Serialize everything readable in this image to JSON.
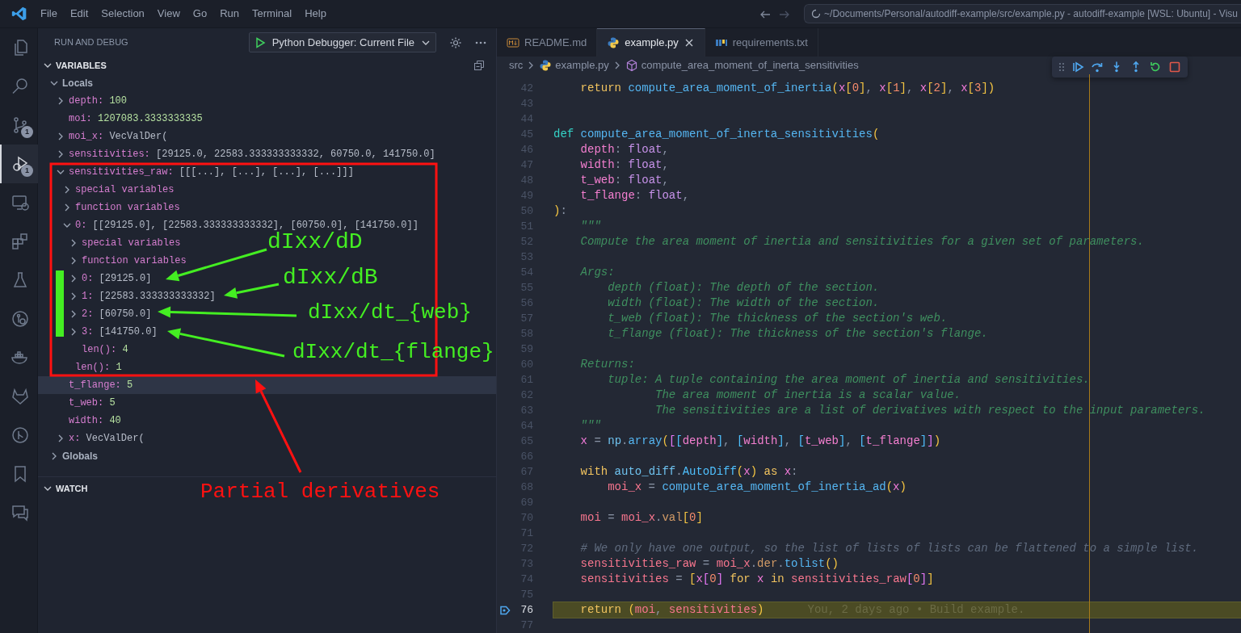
{
  "title_bar": {
    "menu": [
      "File",
      "Edit",
      "Selection",
      "View",
      "Go",
      "Run",
      "Terminal",
      "Help"
    ],
    "command_center": "~/Documents/Personal/autodiff-example/src/example.py - autodiff-example [WSL: Ubuntu] - Visu"
  },
  "activity_bar": [
    {
      "kind": "files",
      "selected": false
    },
    {
      "kind": "search",
      "selected": false
    },
    {
      "kind": "source-control",
      "selected": false,
      "badge": "1"
    },
    {
      "kind": "run-debug",
      "selected": true,
      "badge": "1"
    },
    {
      "kind": "remote",
      "selected": false
    },
    {
      "kind": "extensions",
      "selected": false
    },
    {
      "kind": "testing",
      "selected": false
    },
    {
      "kind": "git-graph",
      "selected": false
    },
    {
      "kind": "docker",
      "selected": false
    },
    {
      "kind": "gitlab",
      "selected": false
    },
    {
      "kind": "git-circle",
      "selected": false
    },
    {
      "kind": "bookmark",
      "selected": false
    },
    {
      "kind": "comments",
      "selected": false
    }
  ],
  "sidebar": {
    "title": "RUN AND DEBUG",
    "launch_config": "Python Debugger: Current File",
    "variables": {
      "title": "VARIABLES",
      "expanded": true,
      "scopes": [
        {
          "label": "Locals",
          "expanded": true,
          "children": [
            {
              "name": "depth:",
              "value": {
                "text": "100",
                "kind": "number"
              },
              "kind": "expandable",
              "expanded": false,
              "selected": false
            },
            {
              "name": "moi:",
              "value": {
                "text": "1207083.3333333335",
                "kind": "number"
              },
              "kind": "leaf",
              "selected": false
            },
            {
              "name": "moi_x:",
              "value": {
                "text": "VecValDer(",
                "kind": "object"
              },
              "kind": "expandable",
              "expanded": false,
              "selected": false
            },
            {
              "name": "sensitivities:",
              "value": {
                "text": "[29125.0, 22583.333333333332, 60750.0, 141750.0]",
                "kind": "object"
              },
              "kind": "expandable",
              "expanded": false,
              "selected": false
            },
            {
              "name": "sensitivities_raw:",
              "value": {
                "text": "[[[...], [...], [...], [...]]]",
                "kind": "object"
              },
              "kind": "expandable",
              "expanded": true,
              "selected": false,
              "children": [
                {
                  "name": "special variables",
                  "kind": "expandable",
                  "expanded": false,
                  "selected": false
                },
                {
                  "name": "function variables",
                  "kind": "expandable",
                  "expanded": false,
                  "selected": false
                },
                {
                  "name": "0:",
                  "value": {
                    "text": "[[29125.0], [22583.333333333332], [60750.0], [141750.0]]",
                    "kind": "object"
                  },
                  "kind": "expandable",
                  "expanded": true,
                  "selected": false,
                  "children": [
                    {
                      "name": "special variables",
                      "kind": "expandable",
                      "expanded": false,
                      "selected": false
                    },
                    {
                      "name": "function variables",
                      "kind": "expandable",
                      "expanded": false,
                      "selected": false
                    },
                    {
                      "name": "0:",
                      "value": {
                        "text": "[29125.0]",
                        "kind": "object"
                      },
                      "kind": "expandable",
                      "expanded": false,
                      "selected": false
                    },
                    {
                      "name": "1:",
                      "value": {
                        "text": "[22583.333333333332]",
                        "kind": "object"
                      },
                      "kind": "expandable",
                      "expanded": false,
                      "selected": false
                    },
                    {
                      "name": "2:",
                      "value": {
                        "text": "[60750.0]",
                        "kind": "object"
                      },
                      "kind": "expandable",
                      "expanded": false,
                      "selected": false
                    },
                    {
                      "name": "3:",
                      "value": {
                        "text": "[141750.0]",
                        "kind": "object"
                      },
                      "kind": "expandable",
                      "expanded": false,
                      "selected": false
                    },
                    {
                      "name": "len():",
                      "value": {
                        "text": "4",
                        "kind": "number"
                      },
                      "kind": "leaf",
                      "selected": false
                    }
                  ]
                },
                {
                  "name": "len():",
                  "value": {
                    "text": "1",
                    "kind": "number"
                  },
                  "kind": "leaf",
                  "selected": false
                }
              ]
            },
            {
              "name": "t_flange:",
              "value": {
                "text": "5",
                "kind": "number"
              },
              "kind": "leaf",
              "selected": true
            },
            {
              "name": "t_web:",
              "value": {
                "text": "5",
                "kind": "number"
              },
              "kind": "leaf",
              "selected": false
            },
            {
              "name": "width:",
              "value": {
                "text": "40",
                "kind": "number"
              },
              "kind": "leaf",
              "selected": false
            },
            {
              "name": "x:",
              "value": {
                "text": "VecValDer(",
                "kind": "object"
              },
              "kind": "expandable",
              "expanded": false,
              "selected": false
            }
          ]
        },
        {
          "label": "Globals",
          "expanded": false
        }
      ]
    },
    "watch": {
      "title": "WATCH",
      "expanded": true
    }
  },
  "tabs": [
    {
      "label": "README.md",
      "kind": "markdown",
      "selected": false
    },
    {
      "label": "example.py",
      "kind": "python",
      "selected": true
    },
    {
      "label": "requirements.txt",
      "kind": "pip",
      "selected": false
    }
  ],
  "breadcrumb": [
    {
      "text": "src",
      "kind": "folder"
    },
    {
      "text": "example.py",
      "kind": "python"
    },
    {
      "text": "compute_area_moment_of_inerta_sensitivities",
      "kind": "symbol"
    }
  ],
  "debug_toolbar": [
    {
      "kind": "continue"
    },
    {
      "kind": "step-over"
    },
    {
      "kind": "step-into"
    },
    {
      "kind": "step-out"
    },
    {
      "kind": "restart"
    },
    {
      "kind": "stop"
    }
  ],
  "editor": {
    "lines": [
      {
        "number": "42",
        "current": false,
        "tokens": [
          {
            "kind": "keyword",
            "text": "    return"
          },
          {
            "kind": "function",
            "text": " compute_area_moment_of_inertia"
          },
          {
            "kind": "bracket",
            "text": "("
          },
          {
            "kind": "xvar",
            "text": "x"
          },
          {
            "kind": "bracket",
            "text": "["
          },
          {
            "kind": "number",
            "text": "0"
          },
          {
            "kind": "bracket",
            "text": "]"
          },
          {
            "kind": "punct",
            "text": ", "
          },
          {
            "kind": "xvar",
            "text": "x"
          },
          {
            "kind": "bracket",
            "text": "["
          },
          {
            "kind": "number",
            "text": "1"
          },
          {
            "kind": "bracket",
            "text": "]"
          },
          {
            "kind": "punct",
            "text": ", "
          },
          {
            "kind": "xvar",
            "text": "x"
          },
          {
            "kind": "bracket",
            "text": "["
          },
          {
            "kind": "number",
            "text": "2"
          },
          {
            "kind": "bracket",
            "text": "]"
          },
          {
            "kind": "punct",
            "text": ", "
          },
          {
            "kind": "xvar",
            "text": "x"
          },
          {
            "kind": "bracket",
            "text": "["
          },
          {
            "kind": "number",
            "text": "3"
          },
          {
            "kind": "bracket",
            "text": "]"
          },
          {
            "kind": "bracket",
            "text": ")"
          }
        ]
      },
      {
        "number": "43",
        "current": false
      },
      {
        "number": "44",
        "current": false
      },
      {
        "number": "45",
        "current": false,
        "tokens": [
          {
            "kind": "def",
            "text": "def"
          },
          {
            "kind": "function",
            "text": " compute_area_moment_of_inerta_sensitivities"
          },
          {
            "kind": "bracket",
            "text": "("
          }
        ]
      },
      {
        "number": "46",
        "current": false,
        "tokens": [
          {
            "kind": "param",
            "text": "    depth"
          },
          {
            "kind": "punct",
            "text": ": "
          },
          {
            "kind": "type",
            "text": "float"
          },
          {
            "kind": "punct",
            "text": ","
          }
        ]
      },
      {
        "number": "47",
        "current": false,
        "tokens": [
          {
            "kind": "param",
            "text": "    width"
          },
          {
            "kind": "punct",
            "text": ": "
          },
          {
            "kind": "type",
            "text": "float"
          },
          {
            "kind": "punct",
            "text": ","
          }
        ]
      },
      {
        "number": "48",
        "current": false,
        "tokens": [
          {
            "kind": "param",
            "text": "    t_web"
          },
          {
            "kind": "punct",
            "text": ": "
          },
          {
            "kind": "type",
            "text": "float"
          },
          {
            "kind": "punct",
            "text": ","
          }
        ]
      },
      {
        "number": "49",
        "current": false,
        "tokens": [
          {
            "kind": "param",
            "text": "    t_flange"
          },
          {
            "kind": "punct",
            "text": ": "
          },
          {
            "kind": "type",
            "text": "float"
          },
          {
            "kind": "punct",
            "text": ","
          }
        ]
      },
      {
        "number": "50",
        "current": false,
        "tokens": [
          {
            "kind": "bracket",
            "text": ")"
          },
          {
            "kind": "punct",
            "text": ":"
          }
        ]
      },
      {
        "number": "51",
        "current": false,
        "tokens": [
          {
            "kind": "doc",
            "text": "    \"\"\""
          }
        ]
      },
      {
        "number": "52",
        "current": false,
        "tokens": [
          {
            "kind": "doc",
            "text": "    Compute the area moment of inertia and sensitivities for a given set of parameters."
          }
        ]
      },
      {
        "number": "53",
        "current": false
      },
      {
        "number": "54",
        "current": false,
        "tokens": [
          {
            "kind": "doc",
            "text": "    Args:"
          }
        ]
      },
      {
        "number": "55",
        "current": false,
        "tokens": [
          {
            "kind": "doc",
            "text": "        depth (float): The depth of the section."
          }
        ]
      },
      {
        "number": "56",
        "current": false,
        "tokens": [
          {
            "kind": "doc",
            "text": "        width (float): The width of the section."
          }
        ]
      },
      {
        "number": "57",
        "current": false,
        "tokens": [
          {
            "kind": "doc",
            "text": "        t_web (float): The thickness of the section's web."
          }
        ]
      },
      {
        "number": "58",
        "current": false,
        "tokens": [
          {
            "kind": "doc",
            "text": "        t_flange (float): The thickness of the section's flange."
          }
        ]
      },
      {
        "number": "59",
        "current": false
      },
      {
        "number": "60",
        "current": false,
        "tokens": [
          {
            "kind": "doc",
            "text": "    Returns:"
          }
        ]
      },
      {
        "number": "61",
        "current": false,
        "tokens": [
          {
            "kind": "doc",
            "text": "        tuple: A tuple containing the area moment of inertia and sensitivities."
          }
        ]
      },
      {
        "number": "62",
        "current": false,
        "tokens": [
          {
            "kind": "doc",
            "text": "               The area moment of inertia is a scalar value."
          }
        ]
      },
      {
        "number": "63",
        "current": false,
        "tokens": [
          {
            "kind": "doc",
            "text": "               The sensitivities are a list of derivatives with respect to the input parameters."
          }
        ]
      },
      {
        "number": "64",
        "current": false,
        "tokens": [
          {
            "kind": "doc",
            "text": "    \"\"\""
          }
        ]
      },
      {
        "number": "65",
        "current": false,
        "tokens": [
          {
            "kind": "xvar",
            "text": "    x"
          },
          {
            "kind": "punct",
            "text": " = "
          },
          {
            "kind": "module",
            "text": "np"
          },
          {
            "kind": "punct",
            "text": "."
          },
          {
            "kind": "function",
            "text": "array"
          },
          {
            "kind": "bracket",
            "text": "("
          },
          {
            "kind": "bracket2",
            "text": "["
          },
          {
            "kind": "bracket3",
            "text": "["
          },
          {
            "kind": "param",
            "text": "depth"
          },
          {
            "kind": "bracket3",
            "text": "]"
          },
          {
            "kind": "punct",
            "text": ", "
          },
          {
            "kind": "bracket3",
            "text": "["
          },
          {
            "kind": "param",
            "text": "width"
          },
          {
            "kind": "bracket3",
            "text": "]"
          },
          {
            "kind": "punct",
            "text": ", "
          },
          {
            "kind": "bracket3",
            "text": "["
          },
          {
            "kind": "param",
            "text": "t_web"
          },
          {
            "kind": "bracket3",
            "text": "]"
          },
          {
            "kind": "punct",
            "text": ", "
          },
          {
            "kind": "bracket3",
            "text": "["
          },
          {
            "kind": "param",
            "text": "t_flange"
          },
          {
            "kind": "bracket3",
            "text": "]"
          },
          {
            "kind": "bracket2",
            "text": "]"
          },
          {
            "kind": "bracket",
            "text": ")"
          }
        ]
      },
      {
        "number": "66",
        "current": false
      },
      {
        "number": "67",
        "current": false,
        "tokens": [
          {
            "kind": "keyword",
            "text": "    with"
          },
          {
            "kind": "module",
            "text": " auto_diff"
          },
          {
            "kind": "punct",
            "text": "."
          },
          {
            "kind": "class",
            "text": "AutoDiff"
          },
          {
            "kind": "bracket",
            "text": "("
          },
          {
            "kind": "xvar",
            "text": "x"
          },
          {
            "kind": "bracket",
            "text": ")"
          },
          {
            "kind": "keyword",
            "text": " as"
          },
          {
            "kind": "xvar",
            "text": " x"
          },
          {
            "kind": "punct",
            "text": ":"
          }
        ]
      },
      {
        "number": "68",
        "current": false,
        "tokens": [
          {
            "kind": "var",
            "text": "        moi_x"
          },
          {
            "kind": "punct",
            "text": " = "
          },
          {
            "kind": "function",
            "text": "compute_area_moment_of_inertia_ad"
          },
          {
            "kind": "bracket",
            "text": "("
          },
          {
            "kind": "xvar",
            "text": "x"
          },
          {
            "kind": "bracket",
            "text": ")"
          }
        ]
      },
      {
        "number": "69",
        "current": false
      },
      {
        "number": "70",
        "current": false,
        "tokens": [
          {
            "kind": "var",
            "text": "    moi"
          },
          {
            "kind": "punct",
            "text": " = "
          },
          {
            "kind": "var",
            "text": "moi_x"
          },
          {
            "kind": "punct",
            "text": "."
          },
          {
            "kind": "attr",
            "text": "val"
          },
          {
            "kind": "bracket",
            "text": "["
          },
          {
            "kind": "number",
            "text": "0"
          },
          {
            "kind": "bracket",
            "text": "]"
          }
        ]
      },
      {
        "number": "71",
        "current": false
      },
      {
        "number": "72",
        "current": false,
        "tokens": [
          {
            "kind": "comment",
            "text": "    # We only have one output, so the list of lists of lists can be flattened to a simple list."
          }
        ]
      },
      {
        "number": "73",
        "current": false,
        "tokens": [
          {
            "kind": "var",
            "text": "    sensitivities_raw"
          },
          {
            "kind": "punct",
            "text": " = "
          },
          {
            "kind": "var",
            "text": "moi_x"
          },
          {
            "kind": "punct",
            "text": "."
          },
          {
            "kind": "attr",
            "text": "der"
          },
          {
            "kind": "punct",
            "text": "."
          },
          {
            "kind": "function",
            "text": "tolist"
          },
          {
            "kind": "bracket",
            "text": "()"
          }
        ]
      },
      {
        "number": "74",
        "current": false,
        "tokens": [
          {
            "kind": "var",
            "text": "    sensitivities"
          },
          {
            "kind": "punct",
            "text": " = "
          },
          {
            "kind": "bracket",
            "text": "["
          },
          {
            "kind": "xvar",
            "text": "x"
          },
          {
            "kind": "bracket2",
            "text": "["
          },
          {
            "kind": "number",
            "text": "0"
          },
          {
            "kind": "bracket2",
            "text": "]"
          },
          {
            "kind": "keyword",
            "text": " for"
          },
          {
            "kind": "xvar",
            "text": " x"
          },
          {
            "kind": "keyword",
            "text": " in"
          },
          {
            "kind": "var",
            "text": " sensitivities_raw"
          },
          {
            "kind": "bracket2",
            "text": "["
          },
          {
            "kind": "number",
            "text": "0"
          },
          {
            "kind": "bracket2",
            "text": "]"
          },
          {
            "kind": "bracket",
            "text": "]"
          }
        ]
      },
      {
        "number": "75",
        "current": false
      },
      {
        "number": "76",
        "current": true,
        "blame": "You, 2 days ago • Build example.",
        "tokens": [
          {
            "kind": "keyword",
            "text": "    return"
          },
          {
            "kind": "bracket",
            "text": " ("
          },
          {
            "kind": "var",
            "text": "moi"
          },
          {
            "kind": "punct",
            "text": ", "
          },
          {
            "kind": "var",
            "text": "sensitivities"
          },
          {
            "kind": "bracket",
            "text": ")"
          }
        ]
      },
      {
        "number": "77",
        "current": false
      }
    ]
  },
  "annotations": [
    {
      "text": "dIxx/dD",
      "color": "#44ee22"
    },
    {
      "text": "dIxx/dB",
      "color": "#44ee22"
    },
    {
      "text": "dIxx/dt_{web}",
      "color": "#44ee22"
    },
    {
      "text": "dIxx/dt_{flange}",
      "color": "#44ee22"
    },
    {
      "text": "Partial derivatives",
      "color": "#ff1111"
    }
  ]
}
